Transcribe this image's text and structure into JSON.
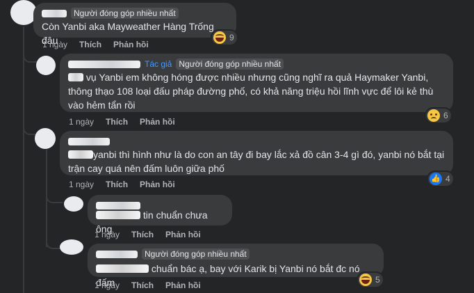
{
  "actions": {
    "time": "1 ngày",
    "like": "Thích",
    "reply": "Phản hồi"
  },
  "comments": [
    {
      "badges": [
        "Người đóng góp nhiều nhất"
      ],
      "text": "Còn Yanbi aka Mayweather Hàng Trống đâu",
      "reaction": {
        "icon": "haha-emoji-icon",
        "count": "9"
      }
    },
    {
      "author_tag": "Tác giả",
      "badges": [
        "Người đóng góp nhiều nhất"
      ],
      "lines": [
        "vụ Yanbi em không hóng được nhiều nhưng cũng nghĩ ra quả Haymaker Yanbi,",
        "thông thạo 108 loại đấu pháp đường phố, có khả năng triệu hồi lĩnh vực để lôi kẻ thù",
        "vào hẻm tẩn rồi"
      ],
      "reaction": {
        "icon": "sad-emoji-icon",
        "count": "6"
      }
    },
    {
      "lines": [
        "yanbi thì hình như là do con an tây đi bay lắc xả đồ cân 3-4 gì đó, yanbi nó bắt tại",
        "trận cay quá nên đấm luôn giữa phố"
      ],
      "reaction": {
        "icon": "like-icon",
        "count": "4"
      }
    },
    {
      "text": "tin chuẩn chưa ông"
    },
    {
      "badges": [
        "Người đóng góp nhiều nhất"
      ],
      "text": "chuẩn bác ạ, bay với Karik bị Yanbi nó bắt đc nó đấm",
      "reaction": {
        "icon": "haha-emoji-icon",
        "count": "5"
      }
    }
  ]
}
